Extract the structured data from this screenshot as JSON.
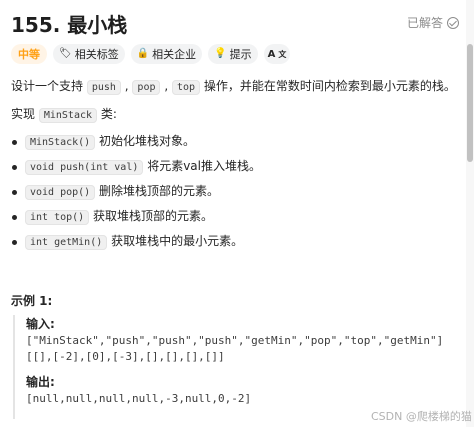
{
  "problem": {
    "title": "155. 最小栈",
    "status": "已解答"
  },
  "tags": [
    {
      "label": "中等",
      "icon": ""
    },
    {
      "label": "相关标签",
      "icon": "tag-icon"
    },
    {
      "label": "相关企业",
      "icon": "lock-icon"
    },
    {
      "label": "提示",
      "icon": "lightbulb-icon"
    },
    {
      "label": "A",
      "icon": "translate-icon"
    }
  ],
  "description": {
    "line1_a": "设计一个支持",
    "code_push": "push",
    "sep1": ",",
    "code_pop": "pop",
    "sep2": ",",
    "code_top": "top",
    "line1_b": "操作，并能在常数时间内检索到最小元素的栈。",
    "impl_a": "实现",
    "impl_code": "MinStack",
    "impl_b": "类:"
  },
  "methods": [
    {
      "code": "MinStack()",
      "text": "初始化堆栈对象。"
    },
    {
      "code": "void push(int val)",
      "text": "将元素val推入堆栈。"
    },
    {
      "code": "void pop()",
      "text": "删除堆栈顶部的元素。"
    },
    {
      "code": "int top()",
      "text": "获取堆栈顶部的元素。"
    },
    {
      "code": "int getMin()",
      "text": "获取堆栈中的最小元素。"
    }
  ],
  "example": {
    "title": "示例 1:",
    "input_label": "输入:",
    "input_line1": "[\"MinStack\",\"push\",\"push\",\"push\",\"getMin\",\"pop\",\"top\",\"getMin\"]",
    "input_line2": "[[],[-2],[0],[-3],[],[],[],[]]",
    "output_label": "输出:",
    "output_line": "[null,null,null,null,-3,null,0,-2]"
  },
  "watermark": "CSDN @爬楼梯的猫"
}
